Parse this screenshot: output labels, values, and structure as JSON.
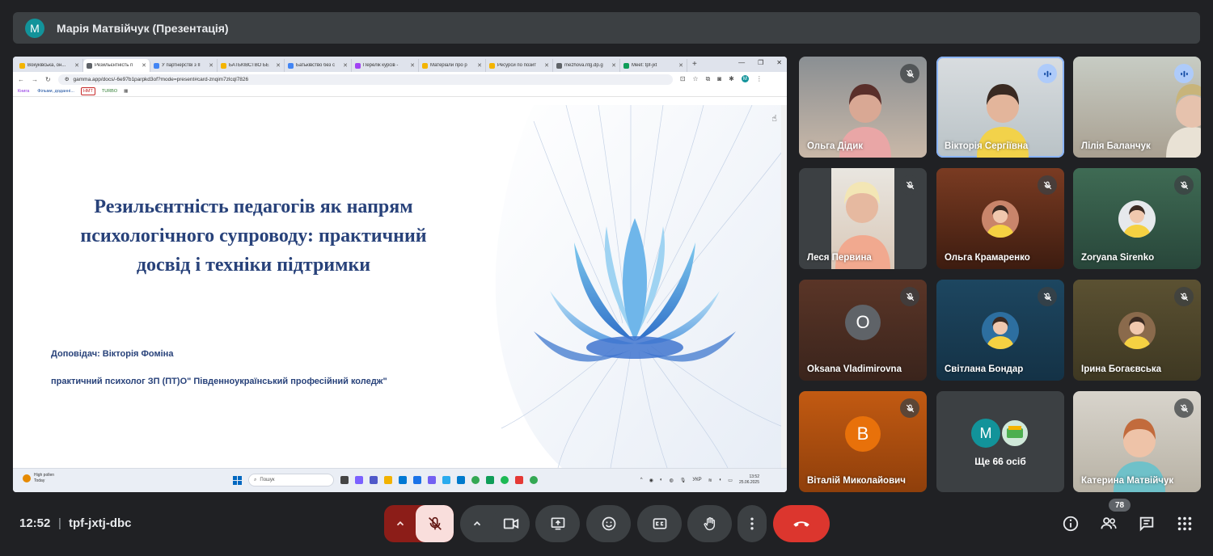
{
  "presenter": {
    "initial": "М",
    "name": "Марія Матвійчук (Презентація)",
    "avatar_color": "#12939a"
  },
  "browser": {
    "tabs": [
      {
        "label": "Вокуківська, он...",
        "fav": "#f4b400"
      },
      {
        "label": "Резильєнтність п",
        "fav": "#5f6368",
        "active": true
      },
      {
        "label": "У партнерстві з ІІ",
        "fav": "#4285f4"
      },
      {
        "label": "БАТЬКІВСТВО БЕ",
        "fav": "#f4b400"
      },
      {
        "label": "Батьківство без с",
        "fav": "#4285f4"
      },
      {
        "label": "Перелік курсів -",
        "fav": "#a142f4"
      },
      {
        "label": "Матеріали про р",
        "fav": "#f4b400"
      },
      {
        "label": "Ресурси по позит",
        "fav": "#f4b400"
      },
      {
        "label": "mezhova.ntg.dp.g",
        "fav": "#5f6368"
      },
      {
        "label": "Meet: tpf-jxt",
        "fav": "#0f9d58"
      }
    ],
    "url": "gamma.app/docs/-6e97b1parpkd3of?mode=present#card-znqim7zlcql7826",
    "bookmarks": [
      "Книга",
      "Фільми, доданні...",
      "НМТ",
      "TURBO"
    ]
  },
  "slide": {
    "title": "Резильєнтність педагогів як напрям психологічного супроводу: практичний досвід і техніки підтримки",
    "speaker": "Доповідач: Вікторія Фоміна",
    "role": "практичний психолог ЗП (ПТ)О\" Південноукраїнський професійний коледж\""
  },
  "taskbar": {
    "weather_title": "High pollen",
    "weather_sub": "Today",
    "search": "Пошук",
    "lang": "УКР",
    "time": "13:52",
    "date": "25.06.2025"
  },
  "participants": [
    {
      "name": "Ольга Дідик",
      "muted": true
    },
    {
      "name": "Вікторія Сергіївна",
      "muted": false,
      "speaking": true
    },
    {
      "name": "Лілія Баланчук",
      "muted": false
    },
    {
      "name": "Леся Первина",
      "muted": true
    },
    {
      "name": "Ольга Крамаренко",
      "muted": true
    },
    {
      "name": "Zoryana Sirenko",
      "muted": true
    },
    {
      "name": "Oksana Vladimirovna",
      "muted": true,
      "initial": "O",
      "avatar_color": "#5f6368"
    },
    {
      "name": "Світлана Бондар",
      "muted": true
    },
    {
      "name": "Ірина Богаєвська",
      "muted": true
    },
    {
      "name": "Віталій Миколайович",
      "muted": true,
      "initial": "В",
      "avatar_color": "#e8710a"
    },
    {
      "name": "Катерина Матвійчук",
      "muted": true
    }
  ],
  "more": {
    "initial": "М",
    "label": "Ще 66 осіб"
  },
  "bottom": {
    "time": "12:52",
    "separator": "|",
    "code": "tpf-jxtj-dbc",
    "people_count": "78"
  },
  "colors": {
    "end_call": "#dc362e",
    "mic_off_bg": "#f9dedc",
    "accent_blue": "#8ab4f8"
  }
}
